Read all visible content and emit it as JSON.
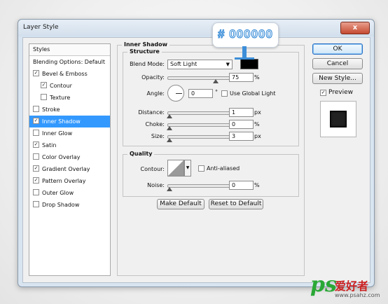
{
  "window": {
    "title": "Layer Style",
    "close_glyph": "x"
  },
  "styles_panel": {
    "header": "Styles",
    "items": [
      {
        "label": "Blending Options: Default",
        "checkbox": false,
        "checked": false,
        "indent": false,
        "selected": false
      },
      {
        "label": "Bevel & Emboss",
        "checkbox": true,
        "checked": true,
        "indent": false,
        "selected": false
      },
      {
        "label": "Contour",
        "checkbox": true,
        "checked": true,
        "indent": true,
        "selected": false
      },
      {
        "label": "Texture",
        "checkbox": true,
        "checked": false,
        "indent": true,
        "selected": false
      },
      {
        "label": "Stroke",
        "checkbox": true,
        "checked": false,
        "indent": false,
        "selected": false
      },
      {
        "label": "Inner Shadow",
        "checkbox": true,
        "checked": true,
        "indent": false,
        "selected": true
      },
      {
        "label": "Inner Glow",
        "checkbox": true,
        "checked": false,
        "indent": false,
        "selected": false
      },
      {
        "label": "Satin",
        "checkbox": true,
        "checked": true,
        "indent": false,
        "selected": false
      },
      {
        "label": "Color Overlay",
        "checkbox": true,
        "checked": false,
        "indent": false,
        "selected": false
      },
      {
        "label": "Gradient Overlay",
        "checkbox": true,
        "checked": true,
        "indent": false,
        "selected": false
      },
      {
        "label": "Pattern Overlay",
        "checkbox": true,
        "checked": true,
        "indent": false,
        "selected": false
      },
      {
        "label": "Outer Glow",
        "checkbox": true,
        "checked": false,
        "indent": false,
        "selected": false
      },
      {
        "label": "Drop Shadow",
        "checkbox": true,
        "checked": false,
        "indent": false,
        "selected": false
      }
    ]
  },
  "inner_shadow": {
    "section_title": "Inner Shadow",
    "structure_title": "Structure",
    "blend_mode_label": "Blend Mode:",
    "blend_mode_value": "Soft Light",
    "shadow_color": "#000000",
    "opacity_label": "Opacity:",
    "opacity_value": "75",
    "opacity_unit": "%",
    "opacity_fraction": 0.75,
    "angle_label": "Angle:",
    "angle_value": "0",
    "angle_unit": "°",
    "use_global_light_label": "Use Global Light",
    "use_global_light_checked": false,
    "distance_label": "Distance:",
    "distance_value": "1",
    "distance_unit": "px",
    "choke_label": "Choke:",
    "choke_value": "0",
    "choke_unit": "%",
    "size_label": "Size:",
    "size_value": "3",
    "size_unit": "px",
    "quality_title": "Quality",
    "contour_label": "Contour:",
    "anti_aliased_label": "Anti-aliased",
    "anti_aliased_checked": false,
    "noise_label": "Noise:",
    "noise_value": "0",
    "noise_unit": "%",
    "make_default_label": "Make Default",
    "reset_default_label": "Reset to Default"
  },
  "buttons": {
    "ok": "OK",
    "cancel": "Cancel",
    "new_style": "New Style...",
    "preview_label": "Preview",
    "preview_checked": true
  },
  "annotation": {
    "color_label": "# 000000",
    "accent": "#3c8fd8"
  },
  "watermark": {
    "logo": "ps",
    "chinese": "爱好者",
    "url": "www.psahz.com"
  }
}
